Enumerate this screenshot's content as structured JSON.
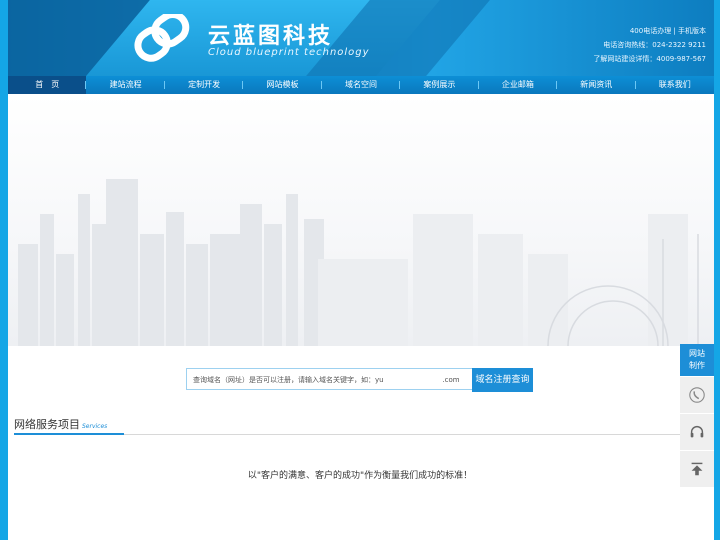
{
  "brand": {
    "title": "云蓝图科技",
    "subtitle": "Cloud blueprint technology"
  },
  "contact": {
    "line1": "400电话办理 | 手机版本",
    "line2": "电话咨询热线：024-2322 9211",
    "line3": "了解网站建设详情：4009-987-567"
  },
  "nav": [
    "首　页",
    "建站流程",
    "定制开发",
    "网站模板",
    "域名空间",
    "案例展示",
    "企业邮箱",
    "新闻资讯",
    "联系我们"
  ],
  "search": {
    "placeholder": "查询域名（网址）是否可以注册，请输入域名关键字，如：yu",
    "suffix": ".com",
    "button": "域名注册查询"
  },
  "section": {
    "title": "网络服务项目",
    "sub": "Services"
  },
  "slogan": "以\"客户的满意、客户的成功\"作为衡量我们成功的标准！",
  "side": {
    "top_label": "网站制作",
    "icons": [
      "phone-icon",
      "headset-icon",
      "back-to-top-icon"
    ]
  },
  "colors": {
    "accent": "#1d8ed7",
    "header_dark": "#0a4f8a",
    "frame": "#14a6e6"
  }
}
